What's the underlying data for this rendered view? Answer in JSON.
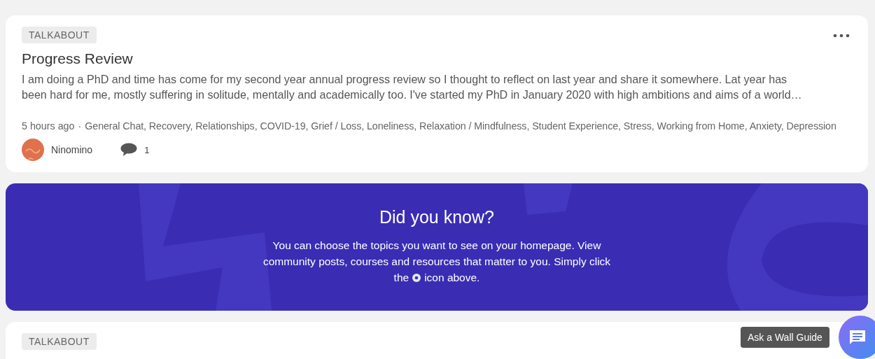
{
  "posts": [
    {
      "tag": "TALKABOUT",
      "title": "Progress Review",
      "excerpt_lines": [
        "I am doing a PhD and time has come for my second year annual progress review so I thought to reflect on last year and share it somewhere. Lat year has",
        "been hard for me, mostly suffering in solitude, mentally and academically too. I've started my PhD in January 2020 with high ambitions and aims of a world…"
      ],
      "time": "5 hours ago",
      "separator": "·",
      "topics": "General Chat, Recovery, Relationships, COVID-19, Grief / Loss, Loneliness, Relaxation / Mindfulness, Student Experience, Stress, Working from Home, Anxiety, Depression",
      "author": "Ninomino",
      "comments": "1"
    }
  ],
  "tip": {
    "title": "Did you know?",
    "lines": [
      "You can choose the topics you want to see on your homepage. View",
      "community posts, courses and resources that matter to you. Simply click"
    ],
    "text_before": "the",
    "text_after": "icon above."
  },
  "next_post": {
    "tag": "TALKABOUT"
  },
  "chat": {
    "tooltip": "Ask a Wall Guide"
  }
}
